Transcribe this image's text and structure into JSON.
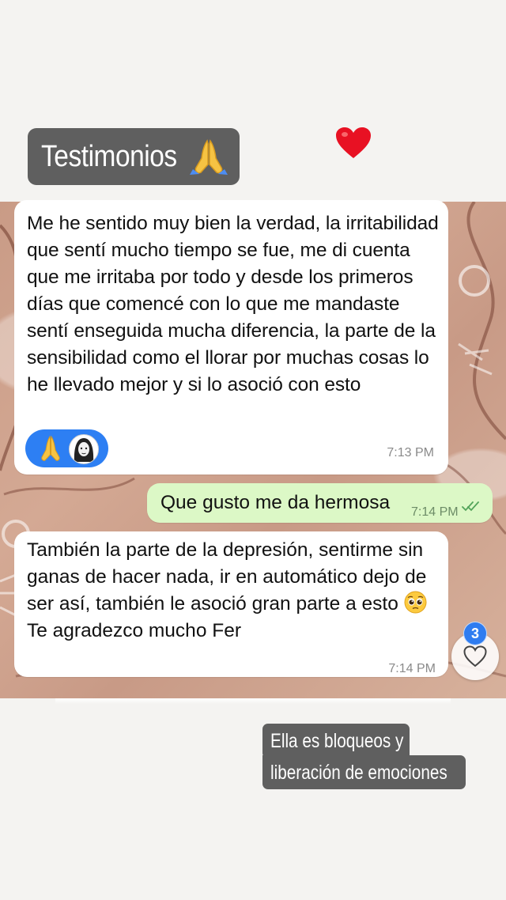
{
  "story": {
    "title": "Testimonios",
    "title_emoji": "folded-hands-icon",
    "decoration": "red-heart-icon",
    "captions": [
      "Ella es bloqueos y",
      "liberación de emociones"
    ]
  },
  "chat": {
    "messages": [
      {
        "direction": "incoming",
        "text": "Me he sentido muy bien la verdad, la irritabilidad que sentí mucho tiempo se fue, me di cuenta que me irritaba por todo y desde los primeros días que comencé con lo que me mandaste sentí enseguida mucha diferencia, la parte de la sensibilidad como el llorar por muchas cosas lo he llevado mejor y si lo asoció con esto",
        "time": "7:13 PM",
        "reactions": [
          "folded-hands-icon",
          "avatar"
        ]
      },
      {
        "direction": "outgoing",
        "text": "Que gusto me da hermosa",
        "time": "7:14 PM",
        "status": "double-check-icon"
      },
      {
        "direction": "incoming",
        "lines": [
          "También la parte de la depresión, sentirme sin ganas de hacer nada, ir en automático dejo de ser así, también le asoció gran parte a esto",
          "Te agradezco mucho Fer"
        ],
        "emoji": "pleading-face-icon",
        "time": "7:14 PM"
      }
    ]
  },
  "like": {
    "count": "3",
    "icon": "heart-outline-icon"
  },
  "colors": {
    "sticker_bg": "#5f5f5f",
    "outgoing_bubble": "#dcf8c6",
    "incoming_bubble": "#ffffff",
    "badge_blue": "#2f7cf0",
    "heart_red": "#e81123"
  }
}
